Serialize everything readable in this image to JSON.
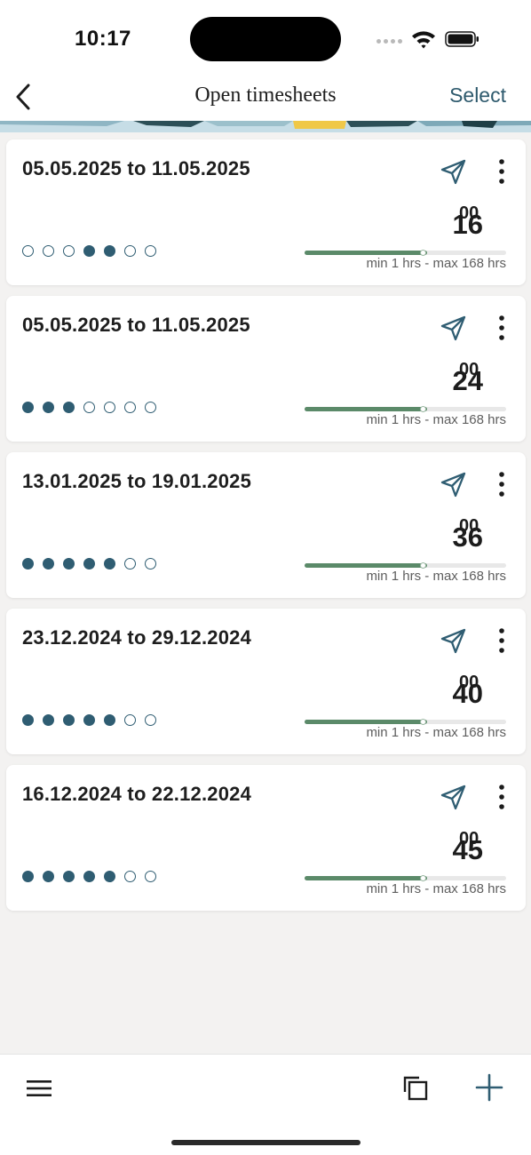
{
  "status_bar": {
    "time": "10:17"
  },
  "nav": {
    "title": "Open timesheets",
    "select_label": "Select"
  },
  "colors": {
    "accent": "#2f5d72",
    "progress": "#5b8a69",
    "background": "#f3f2f1"
  },
  "timesheets": [
    {
      "range": "05.05.2025 to 11.05.2025",
      "hours": "16",
      "minutes": "00",
      "days": [
        false,
        false,
        false,
        true,
        true,
        false,
        false
      ],
      "progress": 0.61,
      "limits": "min 1 hrs - max 168 hrs"
    },
    {
      "range": "05.05.2025 to 11.05.2025",
      "hours": "24",
      "minutes": "00",
      "days": [
        true,
        true,
        true,
        false,
        false,
        false,
        false
      ],
      "progress": 0.61,
      "limits": "min 1 hrs - max 168 hrs"
    },
    {
      "range": "13.01.2025 to 19.01.2025",
      "hours": "36",
      "minutes": "00",
      "days": [
        true,
        true,
        true,
        true,
        true,
        false,
        false
      ],
      "progress": 0.61,
      "limits": "min 1 hrs - max 168 hrs"
    },
    {
      "range": "23.12.2024 to 29.12.2024",
      "hours": "40",
      "minutes": "00",
      "days": [
        true,
        true,
        true,
        true,
        true,
        false,
        false
      ],
      "progress": 0.61,
      "limits": "min 1 hrs - max 168 hrs"
    },
    {
      "range": "16.12.2024 to 22.12.2024",
      "hours": "45",
      "minutes": "00",
      "days": [
        true,
        true,
        true,
        true,
        true,
        false,
        false
      ],
      "progress": 0.61,
      "limits": "min 1 hrs - max 168 hrs"
    }
  ],
  "toolbar": {
    "icons": [
      "hamburger-menu-icon",
      "copy-icon",
      "plus-icon"
    ]
  }
}
